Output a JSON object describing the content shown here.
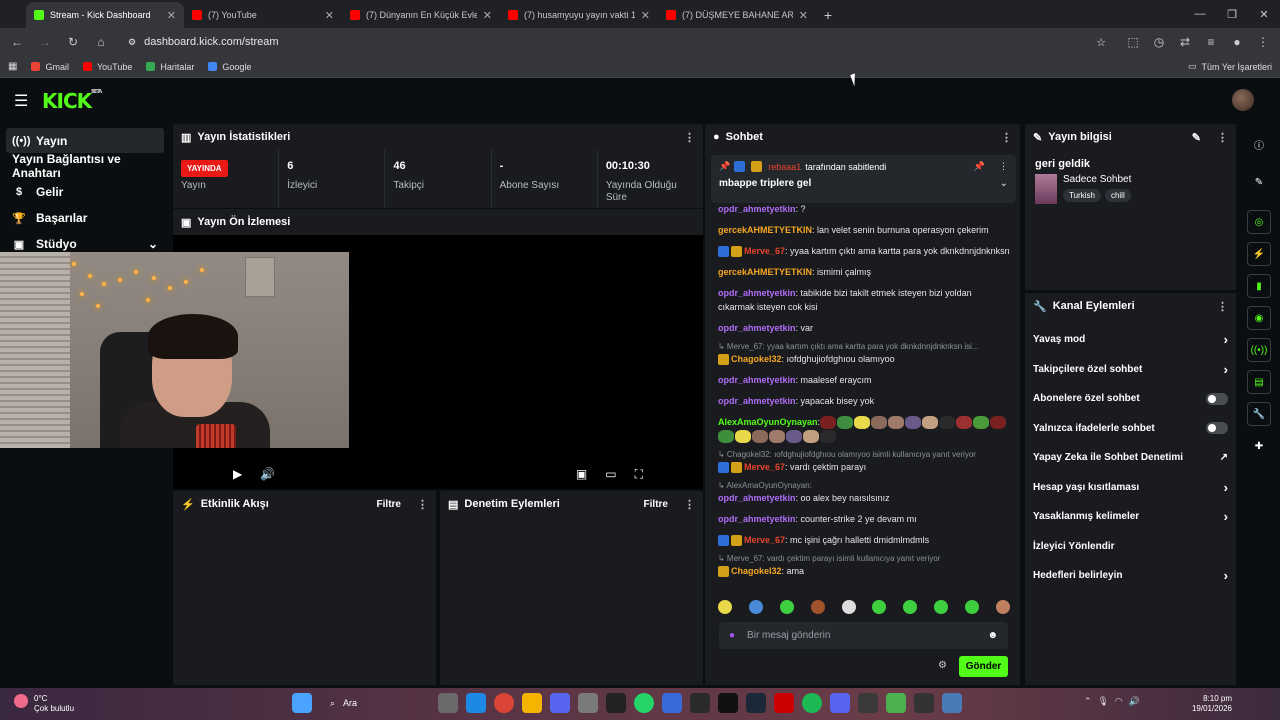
{
  "browser": {
    "tabs": [
      {
        "title": "Stream - Kick Dashboard",
        "color": "#53fc18",
        "active": true
      },
      {
        "title": "(7) YouTube",
        "color": "#ff0000",
        "active": false
      },
      {
        "title": "(7) Dünyanın En Küçük Evleri: 1",
        "color": "#ff0000",
        "active": false
      },
      {
        "title": "(7) husamyuyu yayın vakti 14 -",
        "color": "#ff0000",
        "active": false
      },
      {
        "title": "(7) DÜŞMEYE BAHANE ARAMA!",
        "color": "#ff0000",
        "active": false
      }
    ],
    "url": "dashboard.kick.com/stream",
    "bookmarks": [
      {
        "label": "Gmail",
        "color": "#ea4335"
      },
      {
        "label": "YouTube",
        "color": "#ff0000"
      },
      {
        "label": "Haritalar",
        "color": "#34a853"
      },
      {
        "label": "Google",
        "color": "#4285f4"
      }
    ],
    "all_bookmarks": "Tüm Yer İşaretleri"
  },
  "nav": {
    "items": [
      "Yayın",
      "Yayın Bağlantısı ve Anahtarı",
      "Gelir",
      "Başarılar",
      "Stüdyo"
    ]
  },
  "stats": {
    "title": "Yayın İstatistikleri",
    "live_badge": "YAYINDA",
    "live_label": "Yayın",
    "viewers": "6",
    "viewers_label": "İzleyici",
    "followers": "46",
    "followers_label": "Takipçi",
    "subs": "-",
    "subs_label": "Abone Sayısı",
    "uptime": "00:10:30",
    "uptime_label": "Yayında Olduğu Süre"
  },
  "preview": {
    "title": "Yayın Ön İzlemesi"
  },
  "activity": {
    "title": "Etkinlik Akışı",
    "filter": "Filtre"
  },
  "moderation": {
    "title": "Denetim Eylemleri",
    "filter": "Filtre"
  },
  "chat": {
    "title": "Sohbet",
    "pinned_by_user": "rebaaa1",
    "pinned_by_suffix": " tarafından sabitlendi",
    "pinned_message": "mbappe triplere gel",
    "messages": [
      {
        "user": "opdr_ahmetyetkin",
        "color": "#b06cf5",
        "text": ": ?"
      },
      {
        "user": "gercekAHMETYETKIN",
        "color": "#f5a623",
        "text": ": lan velet senin burnuna operasyon çekerim"
      },
      {
        "user": "Merve_67",
        "color": "#e8452c",
        "text": ": yyaa kartım çıktı ama kartta para yok dknkdnnjdnknksn",
        "badges": true
      },
      {
        "user": "gercekAHMETYETKIN",
        "color": "#f5a623",
        "text": ": ismimi çalmış"
      },
      {
        "user": "opdr_ahmetyetkin",
        "color": "#b06cf5",
        "text": ": tabikide bizi takilt etmek isteyen bizi yoldan cıkarmak isteyen cok kisi"
      },
      {
        "user": "opdr_ahmetyetkin",
        "color": "#b06cf5",
        "text": ": var"
      },
      {
        "reply": "Merve_67: yyaa kartım çıktı ama kartta para yok dknkdnnjdnknksn isi...",
        "user": "Chagokel32",
        "color": "#f5a623",
        "text": ": ıofdghujiofdghıou olamıyoo",
        "crown": true
      },
      {
        "user": "opdr_ahmetyetkin",
        "color": "#b06cf5",
        "text": ": maalesef eraycım"
      },
      {
        "user": "opdr_ahmetyetkin",
        "color": "#b06cf5",
        "text": ": yapacak bisey yok"
      },
      {
        "user": "AlexAmaOyunOynayan",
        "color": "#53fc18",
        "text": ":",
        "emotes": 18
      },
      {
        "reply": "Chagokel32: ıofdghujiofdghıou olamıyoo isimli kullanıcıya yanıt veriyor",
        "user": "Merve_67",
        "color": "#e8452c",
        "text": ": vardı çektim parayı",
        "badges": true
      },
      {
        "reply": "AlexAmaOyunOynayan:",
        "user": "opdr_ahmetyetkin",
        "color": "#b06cf5",
        "text": ": oo alex bey naısılsınız"
      },
      {
        "user": "opdr_ahmetyetkin",
        "color": "#b06cf5",
        "text": ": counter-strike 2 ye devam mı"
      },
      {
        "user": "Merve_67",
        "color": "#e8452c",
        "text": ": mc işini çağrı halletti dmidmlmdmls",
        "badges": true
      },
      {
        "reply": "Merve_67: vardı çektim parayı isimli kullanıcıya yanıt veriyor",
        "user": "Chagokel32",
        "color": "#f5a623",
        "text": ": ama",
        "crown": true
      }
    ],
    "input_placeholder": "Bir mesaj gönderin",
    "send": "Gönder"
  },
  "info": {
    "title": "Yayın bilgisi",
    "stream_title": "geri geldik",
    "category": "Sadece Sohbet",
    "tags": [
      "Turkish",
      "chill"
    ]
  },
  "channel_actions": {
    "title": "Kanal Eylemleri",
    "items": [
      {
        "label": "Yavaş mod",
        "type": "arrow"
      },
      {
        "label": "Takipçilere özel sohbet",
        "type": "arrow"
      },
      {
        "label": "Abonelere özel sohbet",
        "type": "toggle"
      },
      {
        "label": "Yalnızca ifadelerle sohbet",
        "type": "toggle"
      },
      {
        "label": "Yapay Zeka ile Sohbet Denetimi",
        "type": "ext"
      },
      {
        "label": "Hesap yaşı kısıtlaması",
        "type": "arrow"
      },
      {
        "label": "Yasaklanmış kelimeler",
        "type": "arrow"
      },
      {
        "label": "İzleyici Yönlendir",
        "type": "none"
      },
      {
        "label": "Hedefleri belirleyin",
        "type": "arrow"
      }
    ]
  },
  "taskbar": {
    "temp": "0°C",
    "weather": "Çok bulutlu",
    "search": "Ara",
    "time": "8:10 pm",
    "date": "19/01/2026"
  }
}
